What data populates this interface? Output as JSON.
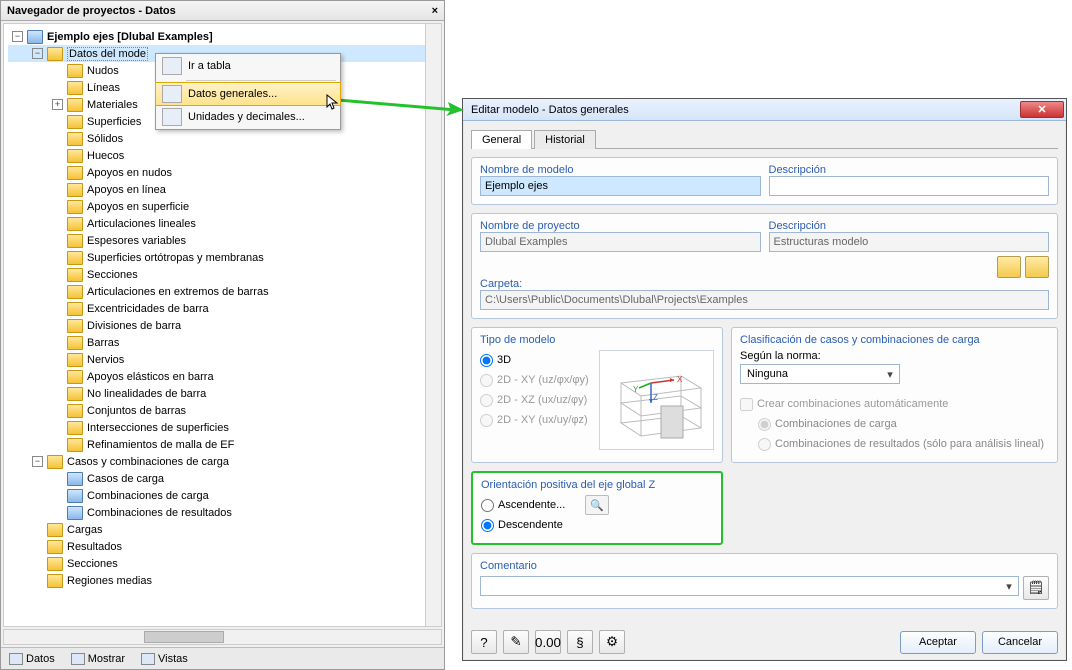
{
  "navigator": {
    "title": "Navegador de proyectos - Datos",
    "root": "Ejemplo ejes [Dlubal Examples]",
    "selected": "Datos del mode",
    "items": [
      "Nudos",
      "Líneas",
      "Materiales",
      "Superficies",
      "Sólidos",
      "Huecos",
      "Apoyos en nudos",
      "Apoyos en línea",
      "Apoyos en superficie",
      "Articulaciones lineales",
      "Espesores variables",
      "Superficies ortótropas y membranas",
      "Secciones",
      "Articulaciones en extremos de barras",
      "Excentricidades de barra",
      "Divisiones de barra",
      "Barras",
      "Nervios",
      "Apoyos elásticos en barra",
      "No linealidades de barra",
      "Conjuntos de barras",
      "Intersecciones de superficies",
      "Refinamientos de malla de EF"
    ],
    "cases_label": "Casos y combinaciones de carga",
    "cases": [
      "Casos de carga",
      "Combinaciones de carga",
      "Combinaciones de resultados"
    ],
    "bottom": [
      "Cargas",
      "Resultados",
      "Secciones",
      "Regiones medias"
    ],
    "tabs": {
      "datos": "Datos",
      "mostrar": "Mostrar",
      "vistas": "Vistas"
    }
  },
  "context_menu": {
    "go_table": "Ir a tabla",
    "general_data": "Datos generales...",
    "units": "Unidades y decimales..."
  },
  "dialog": {
    "title": "Editar modelo - Datos generales",
    "tabs": {
      "general": "General",
      "historial": "Historial"
    },
    "model_name_label": "Nombre de modelo",
    "model_name": "Ejemplo ejes",
    "description_label": "Descripción",
    "description": "",
    "project_name_label": "Nombre de proyecto",
    "project_name": "Dlubal Examples",
    "project_desc": "Estructuras modelo",
    "folder_label": "Carpeta:",
    "folder": "C:\\Users\\Public\\Documents\\Dlubal\\Projects\\Examples",
    "model_type_label": "Tipo de modelo",
    "types": {
      "t3d": "3D",
      "t2dxy": "2D - XY (uᴢ/φx/φy)",
      "t2dxz": "2D - XZ (ux/uᴢ/φy)",
      "t2dxy2": "2D - XY (ux/uy/φᴢ)"
    },
    "classification_label": "Clasificación de casos y combinaciones de carga",
    "norm_label": "Según la norma:",
    "norm_value": "Ninguna",
    "auto_combo": "Crear combinaciones automáticamente",
    "combo_load": "Combinaciones de carga",
    "combo_results": "Combinaciones de resultados (sólo para análisis lineal)",
    "z_orientation_label": "Orientación positiva del eje global Z",
    "ascending": "Ascendente...",
    "descending": "Descendente",
    "comment_label": "Comentario",
    "ok": "Aceptar",
    "cancel": "Cancelar"
  }
}
